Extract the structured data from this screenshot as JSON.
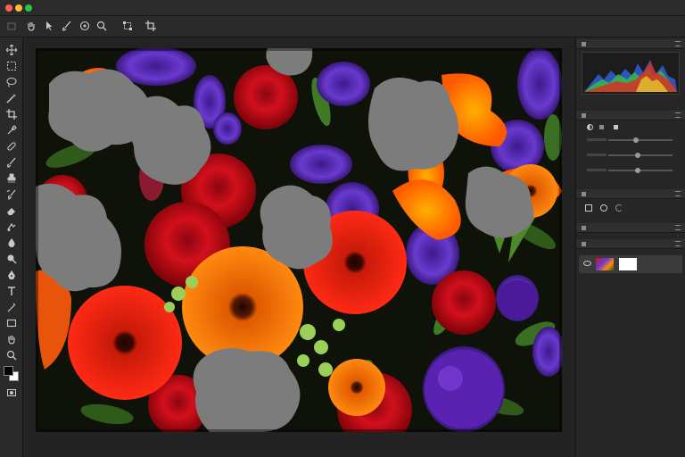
{
  "window": {
    "traffic_lights": [
      "#ff5f57",
      "#febc2e",
      "#28c840"
    ]
  },
  "options_bar": {
    "icons": [
      "home-icon",
      "hand-icon",
      "arrow-icon",
      "brush-icon",
      "target-icon",
      "zoom-icon",
      "transform-icon",
      "crop-icon"
    ]
  },
  "tools": [
    "move-icon",
    "marquee-icon",
    "lasso-icon",
    "magic-wand-icon",
    "crop-icon",
    "eyedropper-icon",
    "healing-icon",
    "brush-icon",
    "clone-stamp-icon",
    "history-brush-icon",
    "eraser-icon",
    "gradient-icon",
    "blur-icon",
    "dodge-icon",
    "pen-icon",
    "type-icon",
    "path-select-icon",
    "rectangle-icon",
    "hand-icon",
    "zoom-icon"
  ],
  "colors": {
    "foreground": "#000000",
    "background": "#ffffff",
    "accent": "#2f7bd6"
  },
  "panels": {
    "histogram": {
      "channels": [
        "red",
        "green",
        "blue"
      ]
    },
    "adjustments": {
      "slider_levels": [
        0.55,
        0.6,
        0.6
      ]
    },
    "layers": {
      "visible": true
    }
  }
}
